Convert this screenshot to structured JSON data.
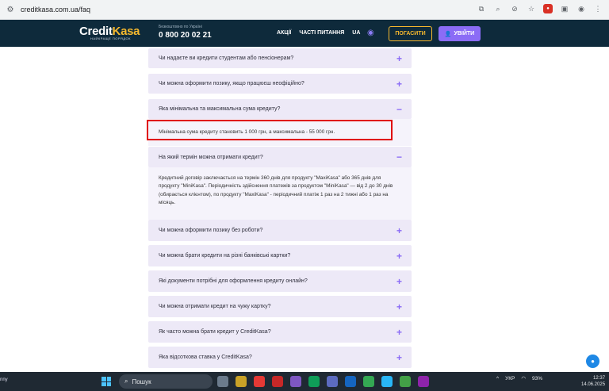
{
  "browser": {
    "url": "creditkasa.com.ua/faq"
  },
  "header": {
    "logo_main": "Credit",
    "logo_accent": "Kasa",
    "logo_tagline": "НАЙКРАЩЕ ПОРЯДОК",
    "phone_note": "Безкоштовно по Україні",
    "phone": "0 800 20 02 21",
    "nav": [
      "АКЦІЇ",
      "ЧАСТІ ПИТАННЯ",
      "UA"
    ],
    "pay_button": "ПОГАСИТИ",
    "login_button": "УВІЙТИ",
    "colors": {
      "bg": "#0e2a3b",
      "accent": "#f5b82e",
      "primary": "#8b6cf6"
    }
  },
  "faq": {
    "items": [
      {
        "question": "Чи надаєте ви кредити студентам або пенсіонерам?",
        "open": false
      },
      {
        "question": "Чи можна оформити позику, якщо працюєш неофіційно?",
        "open": false
      },
      {
        "question": "Яка мінімальна та максимальна сума кредиту?",
        "open": true,
        "answer": "Мінімальна сума кредиту становить 1 000 грн, а максимальна - 55 000 грн."
      },
      {
        "question": "На який термін можна отримати кредит?",
        "open": true,
        "answer": "Кредитний договір заключається на термін 360 днів для продукту \"MaxiKasa\" або 365 днів для продукту \"MiniKasa\". Періодичність здійснення платежів за продуктом \"MiniKasa\" — від 2 до 30 днів (обирається клієнтом), по продукту \"MaxiKasa\" - періодичний платіж 1 раз на 2 тижні або 1 раз на місяць."
      },
      {
        "question": "Чи можна оформити позику без роботи?",
        "open": false
      },
      {
        "question": "Чи можна брати кредити на різні банківські картки?",
        "open": false
      },
      {
        "question": "Які документи потрібні для оформлення кредиту онлайн?",
        "open": false
      },
      {
        "question": "Чи можна отримати кредит на чужу картку?",
        "open": false
      },
      {
        "question": "Як часто можна брати кредит у CreditKasa?",
        "open": false
      },
      {
        "question": "Яка відсоткова ставка у CreditKasa?",
        "open": false
      }
    ]
  },
  "taskbar": {
    "left_text": "nny",
    "search_placeholder": "Пошук",
    "lang": "УКР",
    "battery": "93%",
    "time": "12:37",
    "date": "14.06.2025"
  }
}
